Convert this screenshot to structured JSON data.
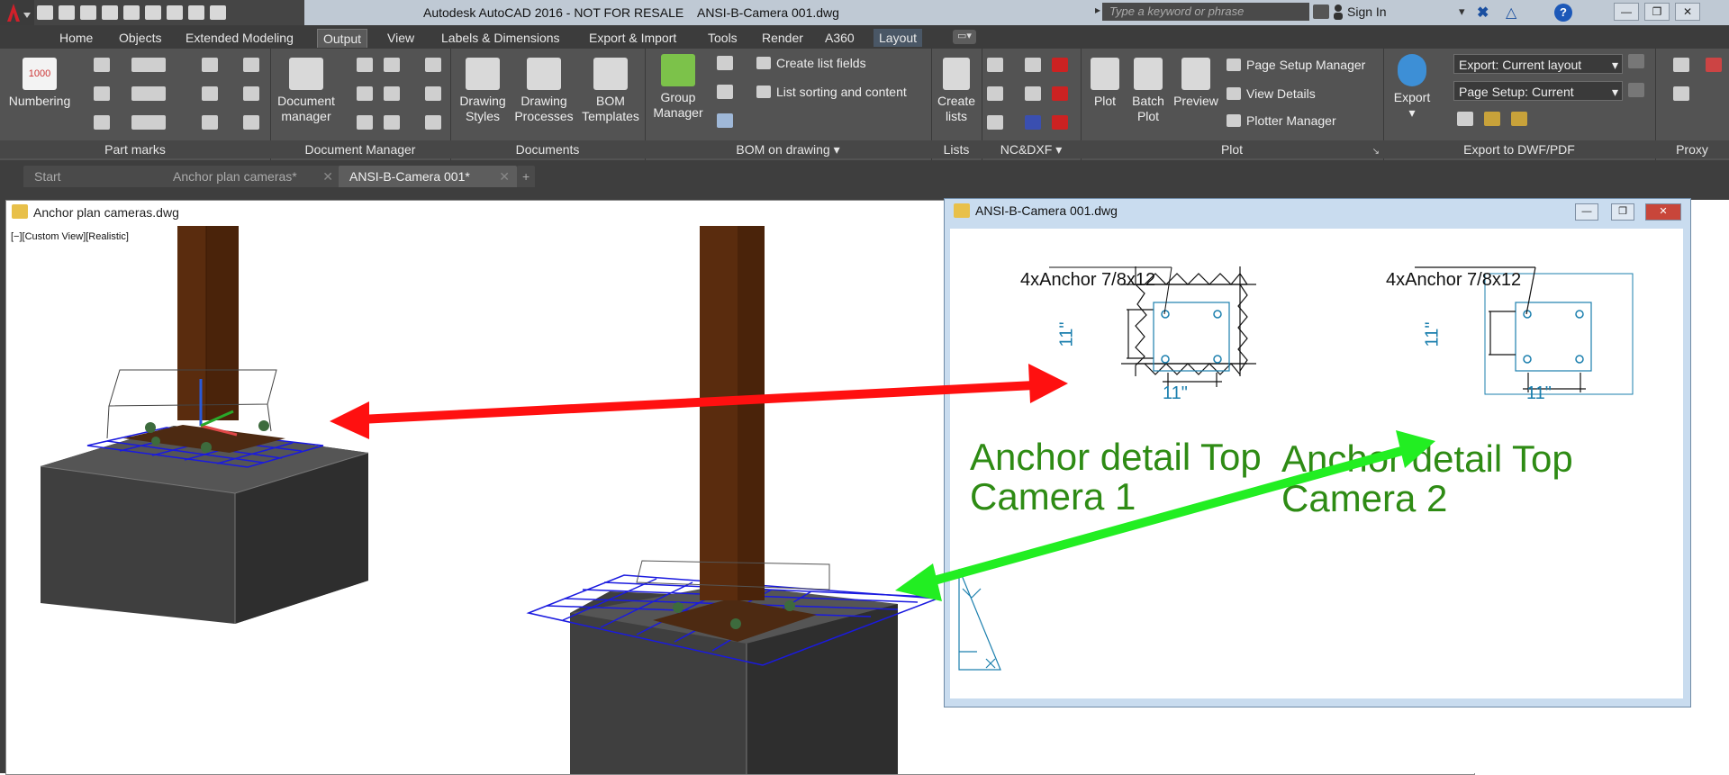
{
  "app": {
    "title": "Autodesk AutoCAD 2016 - NOT FOR RESALE    ANSI-B-Camera 001.dwg",
    "search_placeholder": "Type a keyword or phrase",
    "sign_in": "Sign In"
  },
  "menu_tabs": [
    "Home",
    "Objects",
    "Extended Modeling",
    "Output",
    "View",
    "Labels & Dimensions",
    "Export & Import",
    "Tools",
    "Render",
    "A360",
    "Layout"
  ],
  "ribbon": {
    "panels": {
      "part_marks": "Part marks",
      "document_manager": "Document Manager",
      "documents": "Documents",
      "bom_on_drawing": "BOM on drawing",
      "lists": "Lists",
      "nc_dxf": "NC&DXF",
      "plot": "Plot",
      "export_dwf_pdf": "Export to DWF/PDF",
      "proxy": "Proxy"
    },
    "numbering_icon_text": "1000",
    "numbering": "Numbering",
    "document_manager_btn": [
      "Document",
      "manager"
    ],
    "drawing_styles": [
      "Drawing",
      "Styles"
    ],
    "drawing_processes": [
      "Drawing",
      "Processes"
    ],
    "bom_templates": [
      "BOM",
      "Templates"
    ],
    "group_manager": [
      "Group",
      "Manager"
    ],
    "create_list_fields": "Create list fields",
    "list_sorting": "List sorting and content",
    "create_lists": [
      "Create",
      "lists"
    ],
    "plot": "Plot",
    "batch_plot": [
      "Batch",
      "Plot"
    ],
    "preview": "Preview",
    "page_setup_manager": "Page Setup Manager",
    "view_details": "View Details",
    "plotter_manager": "Plotter Manager",
    "export": "Export",
    "export_combo": "Export: Current layout",
    "page_setup_combo": "Page Setup: Current"
  },
  "doc_tabs": [
    {
      "label": "Start"
    },
    {
      "label": "Anchor plan cameras*"
    },
    {
      "label": "ANSI-B-Camera 001*"
    }
  ],
  "doc_tab_add": "+",
  "left_window": {
    "title": "Anchor plan cameras.dwg",
    "viewport_label": "[−][Custom View][Realistic]"
  },
  "right_window": {
    "title": "ANSI-B-Camera 001.dwg",
    "anchor_label_1": "4xAnchor 7/8x12",
    "anchor_label_2": "4xAnchor 7/8x12",
    "dim": "11\"",
    "detail1": [
      "Anchor detail Top",
      "Camera 1"
    ],
    "detail2": [
      "Anchor detail Top",
      "Camera 2"
    ]
  },
  "colors": {
    "arrow_red": "#ff1010",
    "arrow_green": "#22ee22",
    "detail_text_green": "#2e8b14",
    "dimension_blue": "#1b7fae",
    "column_brown": "#5a2c0e",
    "grid_blue": "#1a1adf"
  }
}
